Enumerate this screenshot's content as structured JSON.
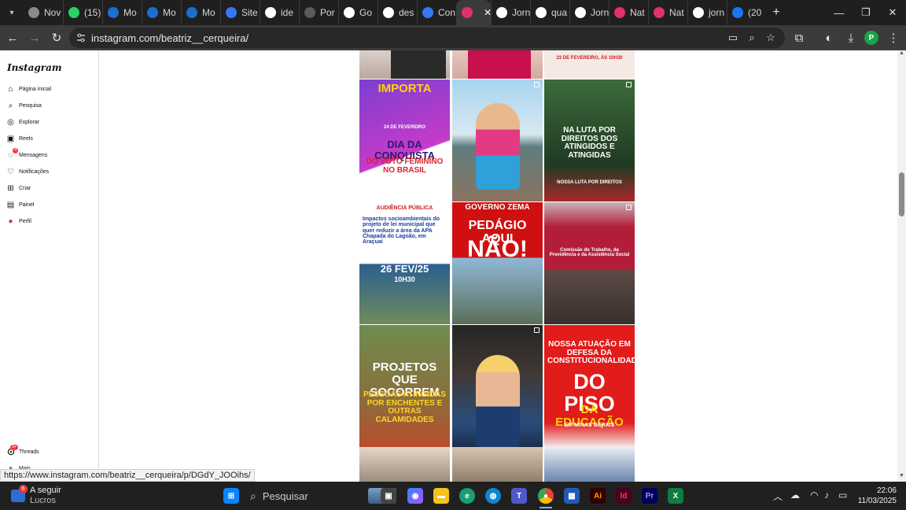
{
  "browser": {
    "tabs": [
      {
        "label": "Nov",
        "icon": "globe-icon",
        "color": "#8a8a8a"
      },
      {
        "label": "(15)",
        "icon": "whatsapp-icon",
        "color": "#25d366"
      },
      {
        "label": "Mo",
        "icon": "moodle-icon",
        "color": "#1b6fcf"
      },
      {
        "label": "Mo",
        "icon": "moodle-icon",
        "color": "#1b6fcf"
      },
      {
        "label": "Mo",
        "icon": "moodle-icon",
        "color": "#1b6fcf"
      },
      {
        "label": "Site",
        "icon": "site-icon",
        "color": "#3478f6"
      },
      {
        "label": "ide",
        "icon": "google-icon",
        "color": "#ffffff"
      },
      {
        "label": "Por",
        "icon": "page-icon",
        "color": "#5a5a5a"
      },
      {
        "label": "Go",
        "icon": "google-icon",
        "color": "#ffffff"
      },
      {
        "label": "des",
        "icon": "google-icon",
        "color": "#ffffff"
      },
      {
        "label": "Con",
        "icon": "calendar-icon",
        "color": "#3478f6"
      },
      {
        "label": "",
        "icon": "instagram-icon",
        "color": "#e1306c",
        "active": true
      },
      {
        "label": "Jorn",
        "icon": "google-icon",
        "color": "#ffffff"
      },
      {
        "label": "qua",
        "icon": "google-icon",
        "color": "#ffffff"
      },
      {
        "label": "Jorn",
        "icon": "google-icon",
        "color": "#ffffff"
      },
      {
        "label": "Nat",
        "icon": "instagram-icon",
        "color": "#e1306c"
      },
      {
        "label": "Nat",
        "icon": "instagram-icon",
        "color": "#e1306c"
      },
      {
        "label": "jorn",
        "icon": "google-icon",
        "color": "#ffffff"
      },
      {
        "label": "(20",
        "icon": "facebook-icon",
        "color": "#1877f2"
      }
    ],
    "url": "instagram.com/beatriz__cerqueira/",
    "profile_initial": "P",
    "status_url": "https://www.instagram.com/beatriz__cerqueira/p/DGdY_JOOihs/"
  },
  "instagram": {
    "logo": "Instagram",
    "nav": [
      {
        "label": "Página inicial",
        "icon": "home-icon"
      },
      {
        "label": "Pesquisa",
        "icon": "search-icon"
      },
      {
        "label": "Explorar",
        "icon": "compass-icon"
      },
      {
        "label": "Reels",
        "icon": "reels-icon"
      },
      {
        "label": "Mensagens",
        "icon": "messenger-icon",
        "badge": "4"
      },
      {
        "label": "Notificações",
        "icon": "heart-icon"
      },
      {
        "label": "Criar",
        "icon": "plus-square-icon"
      },
      {
        "label": "Painel",
        "icon": "dashboard-icon"
      },
      {
        "label": "Perfil",
        "icon": "avatar-icon"
      }
    ],
    "threads": {
      "label": "Threads",
      "badge": "9+"
    },
    "more": {
      "label": "Mais"
    },
    "posts": [
      {
        "lines": [
          "IMPORTA",
          "24 DE FEVEREIRO",
          "DIA DA CONQUISTA",
          "DO VOTO FEMININO NO BRASIL"
        ]
      },
      {
        "lines": []
      },
      {
        "lines": [
          "NA LUTA POR DIREITOS DOS ATINGIDOS E ATINGIDAS",
          "NOSSA LUTA POR DIREITOS"
        ]
      },
      {
        "lines": [
          "AUDIÊNCIA PÚBLICA",
          "Impactos socioambientais do projeto de lei municipal que quer reduzir a área da APA Chapada do Lagoão, em Araçuaí",
          "26 FEV/25",
          "10H30"
        ]
      },
      {
        "lines": [
          "GOVERNO ZEMA",
          "PEDÁGIO AQUI",
          "NÃO!"
        ]
      },
      {
        "lines": [
          "Comissão do Trabalho, da Previdência e da Assistência Social"
        ]
      },
      {
        "lines": [
          "PROJETOS QUE SOCORREM",
          "PESSOAS ATINGIDAS POR ENCHENTES E OUTRAS CALAMIDADES"
        ]
      },
      {
        "lines": []
      },
      {
        "lines": [
          "NOSSA ATUAÇÃO EM DEFESA DA CONSTITUCIONALIDADE",
          "DO PISO",
          "DA EDUCAÇÃO",
          "EM MINAS GERAIS"
        ]
      }
    ],
    "top_row_text": "23 DE FEVEREIRO, ÀS 10H30"
  },
  "taskbar": {
    "weather_title": "A seguir",
    "weather_sub": "Lucros",
    "weather_badge": "6",
    "search_placeholder": "Pesquisar",
    "time": "22:06",
    "date": "11/03/2025"
  }
}
